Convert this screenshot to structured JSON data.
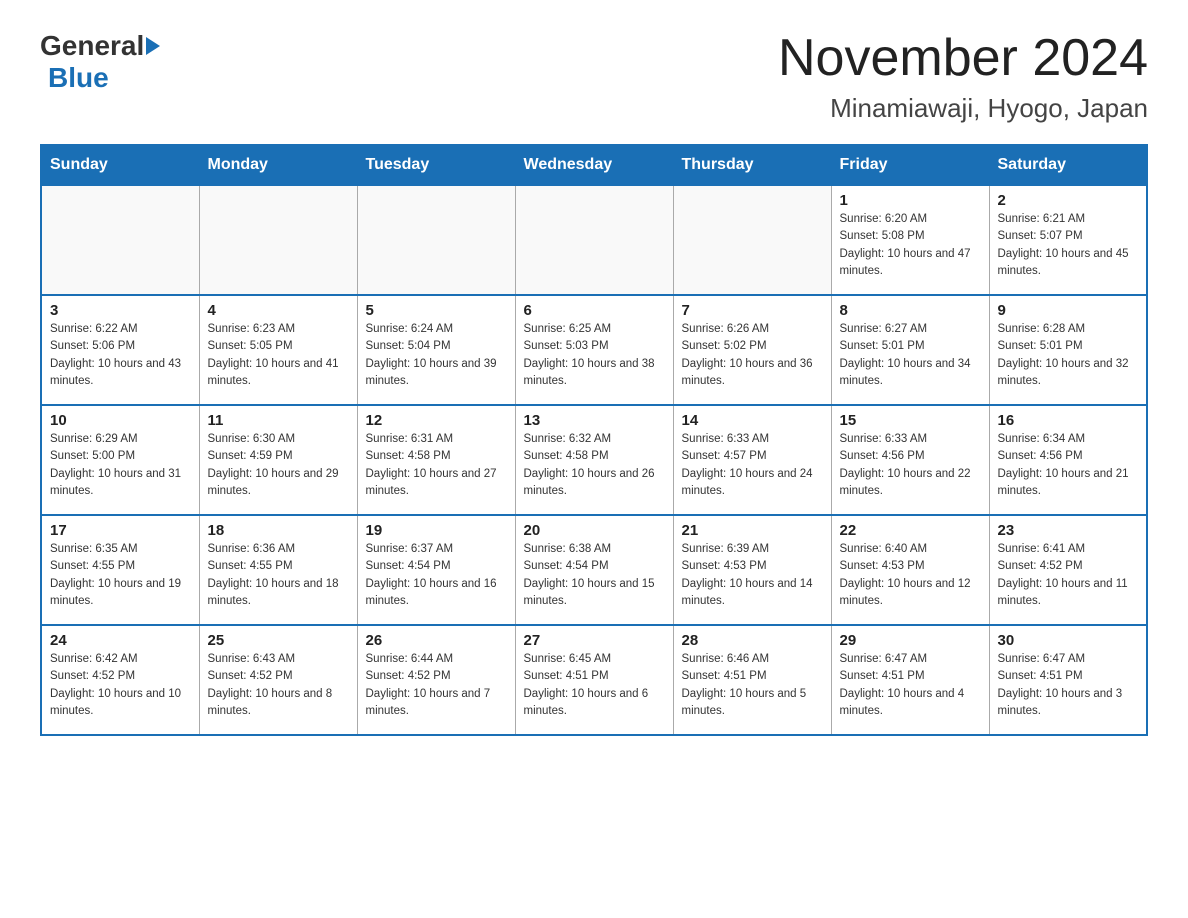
{
  "header": {
    "logo_general": "General",
    "logo_blue": "Blue",
    "month_title": "November 2024",
    "location": "Minamiawaji, Hyogo, Japan"
  },
  "days_of_week": [
    "Sunday",
    "Monday",
    "Tuesday",
    "Wednesday",
    "Thursday",
    "Friday",
    "Saturday"
  ],
  "weeks": [
    [
      {
        "day": "",
        "info": ""
      },
      {
        "day": "",
        "info": ""
      },
      {
        "day": "",
        "info": ""
      },
      {
        "day": "",
        "info": ""
      },
      {
        "day": "",
        "info": ""
      },
      {
        "day": "1",
        "info": "Sunrise: 6:20 AM\nSunset: 5:08 PM\nDaylight: 10 hours and 47 minutes."
      },
      {
        "day": "2",
        "info": "Sunrise: 6:21 AM\nSunset: 5:07 PM\nDaylight: 10 hours and 45 minutes."
      }
    ],
    [
      {
        "day": "3",
        "info": "Sunrise: 6:22 AM\nSunset: 5:06 PM\nDaylight: 10 hours and 43 minutes."
      },
      {
        "day": "4",
        "info": "Sunrise: 6:23 AM\nSunset: 5:05 PM\nDaylight: 10 hours and 41 minutes."
      },
      {
        "day": "5",
        "info": "Sunrise: 6:24 AM\nSunset: 5:04 PM\nDaylight: 10 hours and 39 minutes."
      },
      {
        "day": "6",
        "info": "Sunrise: 6:25 AM\nSunset: 5:03 PM\nDaylight: 10 hours and 38 minutes."
      },
      {
        "day": "7",
        "info": "Sunrise: 6:26 AM\nSunset: 5:02 PM\nDaylight: 10 hours and 36 minutes."
      },
      {
        "day": "8",
        "info": "Sunrise: 6:27 AM\nSunset: 5:01 PM\nDaylight: 10 hours and 34 minutes."
      },
      {
        "day": "9",
        "info": "Sunrise: 6:28 AM\nSunset: 5:01 PM\nDaylight: 10 hours and 32 minutes."
      }
    ],
    [
      {
        "day": "10",
        "info": "Sunrise: 6:29 AM\nSunset: 5:00 PM\nDaylight: 10 hours and 31 minutes."
      },
      {
        "day": "11",
        "info": "Sunrise: 6:30 AM\nSunset: 4:59 PM\nDaylight: 10 hours and 29 minutes."
      },
      {
        "day": "12",
        "info": "Sunrise: 6:31 AM\nSunset: 4:58 PM\nDaylight: 10 hours and 27 minutes."
      },
      {
        "day": "13",
        "info": "Sunrise: 6:32 AM\nSunset: 4:58 PM\nDaylight: 10 hours and 26 minutes."
      },
      {
        "day": "14",
        "info": "Sunrise: 6:33 AM\nSunset: 4:57 PM\nDaylight: 10 hours and 24 minutes."
      },
      {
        "day": "15",
        "info": "Sunrise: 6:33 AM\nSunset: 4:56 PM\nDaylight: 10 hours and 22 minutes."
      },
      {
        "day": "16",
        "info": "Sunrise: 6:34 AM\nSunset: 4:56 PM\nDaylight: 10 hours and 21 minutes."
      }
    ],
    [
      {
        "day": "17",
        "info": "Sunrise: 6:35 AM\nSunset: 4:55 PM\nDaylight: 10 hours and 19 minutes."
      },
      {
        "day": "18",
        "info": "Sunrise: 6:36 AM\nSunset: 4:55 PM\nDaylight: 10 hours and 18 minutes."
      },
      {
        "day": "19",
        "info": "Sunrise: 6:37 AM\nSunset: 4:54 PM\nDaylight: 10 hours and 16 minutes."
      },
      {
        "day": "20",
        "info": "Sunrise: 6:38 AM\nSunset: 4:54 PM\nDaylight: 10 hours and 15 minutes."
      },
      {
        "day": "21",
        "info": "Sunrise: 6:39 AM\nSunset: 4:53 PM\nDaylight: 10 hours and 14 minutes."
      },
      {
        "day": "22",
        "info": "Sunrise: 6:40 AM\nSunset: 4:53 PM\nDaylight: 10 hours and 12 minutes."
      },
      {
        "day": "23",
        "info": "Sunrise: 6:41 AM\nSunset: 4:52 PM\nDaylight: 10 hours and 11 minutes."
      }
    ],
    [
      {
        "day": "24",
        "info": "Sunrise: 6:42 AM\nSunset: 4:52 PM\nDaylight: 10 hours and 10 minutes."
      },
      {
        "day": "25",
        "info": "Sunrise: 6:43 AM\nSunset: 4:52 PM\nDaylight: 10 hours and 8 minutes."
      },
      {
        "day": "26",
        "info": "Sunrise: 6:44 AM\nSunset: 4:52 PM\nDaylight: 10 hours and 7 minutes."
      },
      {
        "day": "27",
        "info": "Sunrise: 6:45 AM\nSunset: 4:51 PM\nDaylight: 10 hours and 6 minutes."
      },
      {
        "day": "28",
        "info": "Sunrise: 6:46 AM\nSunset: 4:51 PM\nDaylight: 10 hours and 5 minutes."
      },
      {
        "day": "29",
        "info": "Sunrise: 6:47 AM\nSunset: 4:51 PM\nDaylight: 10 hours and 4 minutes."
      },
      {
        "day": "30",
        "info": "Sunrise: 6:47 AM\nSunset: 4:51 PM\nDaylight: 10 hours and 3 minutes."
      }
    ]
  ]
}
